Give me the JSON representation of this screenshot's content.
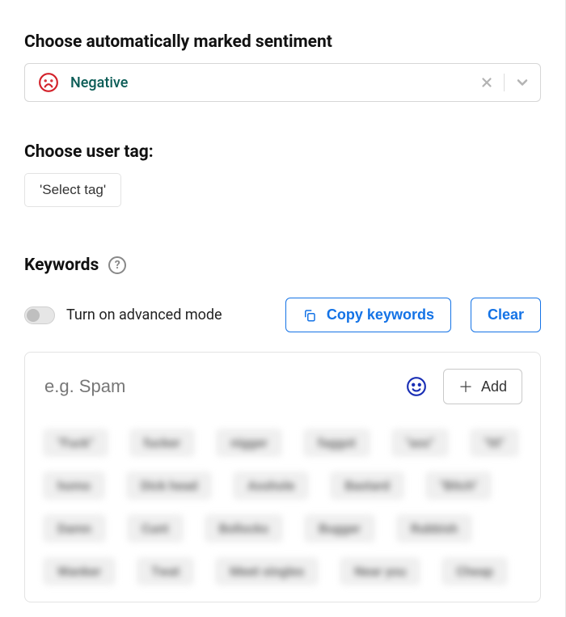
{
  "sentiment": {
    "label": "Choose automatically marked sentiment",
    "value": "Negative",
    "icon": "sad-face-icon"
  },
  "userTag": {
    "label": "Choose user tag:",
    "selectText": "'Select tag'"
  },
  "keywords": {
    "label": "Keywords",
    "advancedToggleLabel": "Turn on advanced mode",
    "advancedOn": false,
    "copyButton": "Copy keywords",
    "clearButton": "Clear",
    "inputPlaceholder": "e.g. Spam",
    "addButton": "Add",
    "chips": [
      "\"Fuck\"",
      "fucker",
      "nigger",
      "faggot",
      "\"ass\"",
      "\"tit\"",
      "homo",
      "Dick head",
      "Asshole",
      "Bastard",
      "\"Bitch\"",
      "Damn",
      "Cunt",
      "Bollocks",
      "Bugger",
      "Rubbish",
      "Wanker",
      "Twat",
      "Meet singles",
      "Near you",
      "Cheap"
    ]
  }
}
